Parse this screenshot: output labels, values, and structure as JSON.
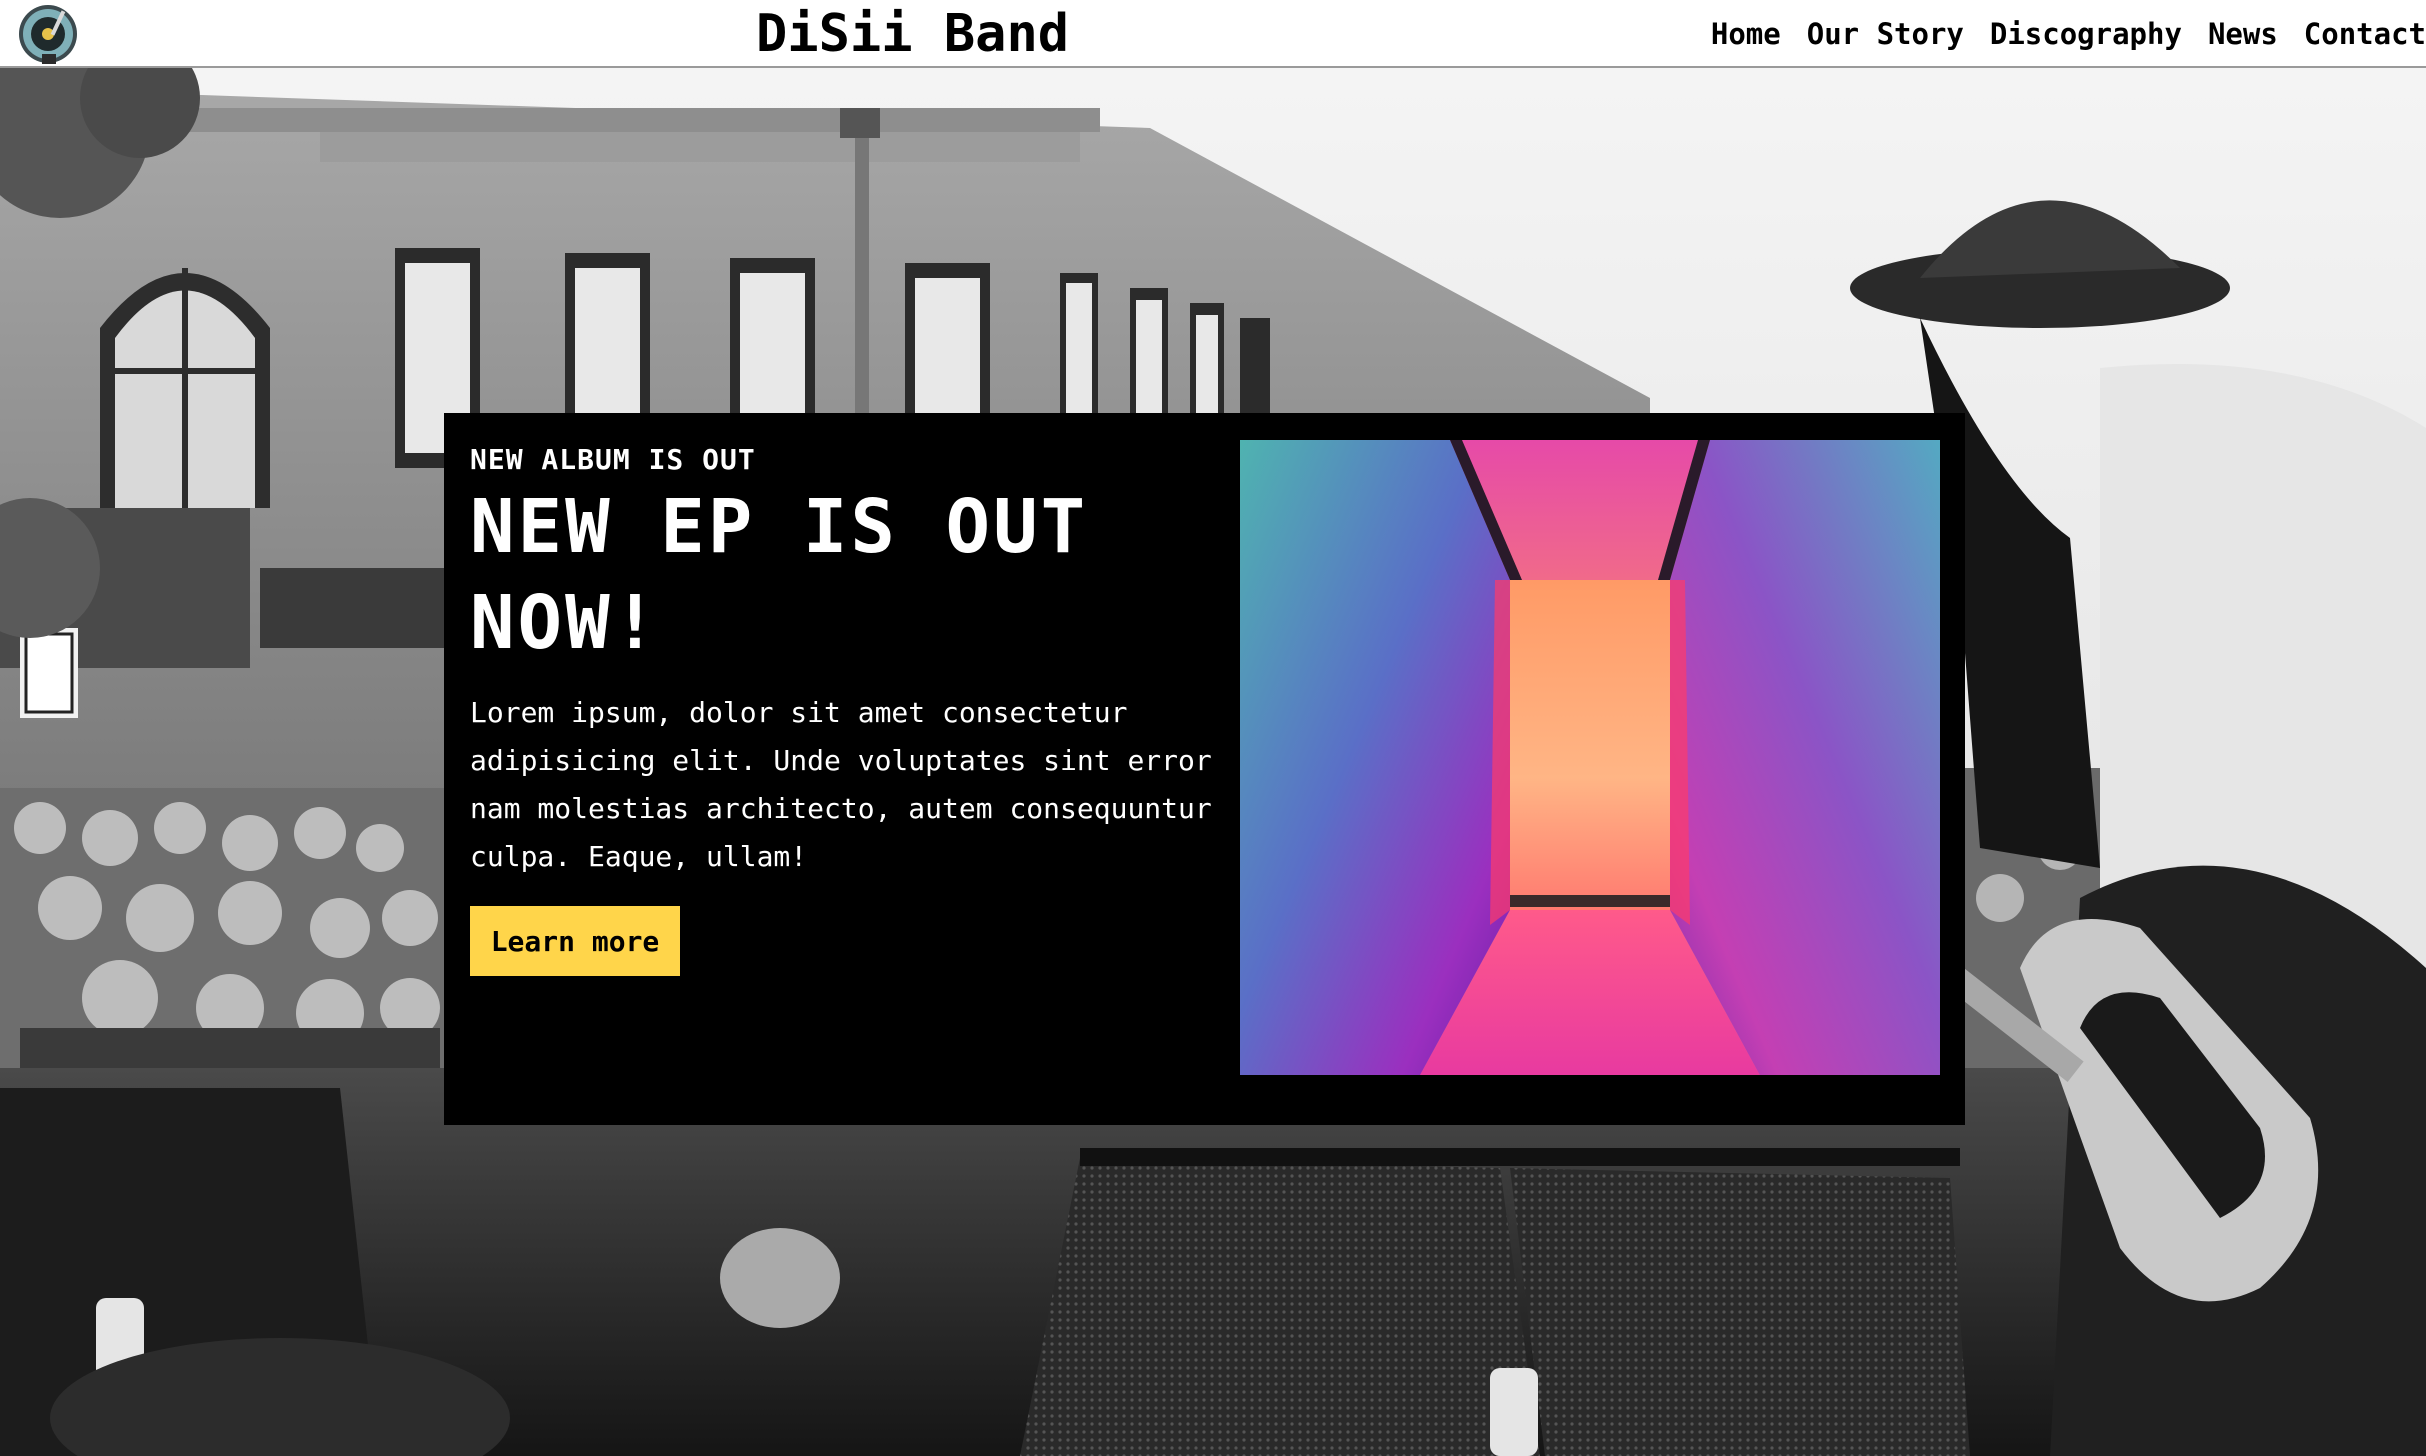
{
  "header": {
    "site_title": "DiSii Band",
    "nav": [
      {
        "label": "Home"
      },
      {
        "label": "Our Story"
      },
      {
        "label": "Discography"
      },
      {
        "label": "News"
      },
      {
        "label": "Contact"
      }
    ],
    "logo_icon": "turntable-logo-icon"
  },
  "hero": {
    "background_image": "black-and-white street concert photo with guitarist",
    "card": {
      "kicker": "NEW ALBUM IS OUT",
      "headline": "NEW EP IS OUT NOW!",
      "body": "Lorem ipsum, dolor sit amet consectetur adipisicing elit. Unde voluptates sint error nam molestias architecto, autem consequuntur culpa. Eaque, ullam!",
      "cta_label": "Learn more",
      "album_art": "neon corridor album cover"
    }
  },
  "colors": {
    "header_bg": "#ffffff",
    "card_bg": "#000000",
    "cta_bg": "#ffd54a",
    "text_light": "#ffffff",
    "text_dark": "#000000"
  }
}
